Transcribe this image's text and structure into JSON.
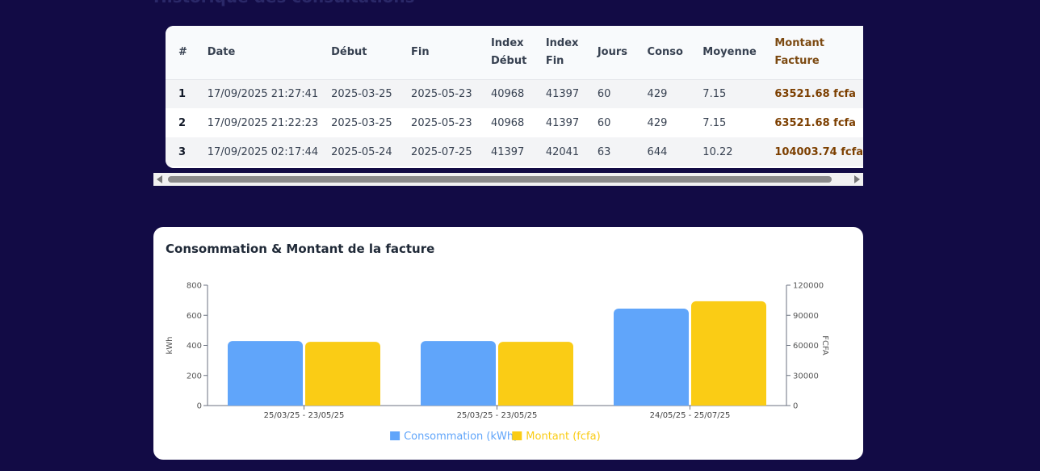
{
  "section_title": "Historique des consultations",
  "table": {
    "headers": {
      "num": "#",
      "date": "Date",
      "debut": "Début",
      "fin": "Fin",
      "index_debut_1": "Index",
      "index_debut_2": "Début",
      "index_fin_1": "Index",
      "index_fin_2": "Fin",
      "jours": "Jours",
      "conso": "Conso",
      "moyenne": "Moyenne",
      "montant_1": "Montant",
      "montant_2": "Facture"
    },
    "rows": [
      {
        "num": "1",
        "date": "17/09/2025 21:27:41",
        "debut": "2025-03-25",
        "fin": "2025-05-23",
        "index_debut": "40968",
        "index_fin": "41397",
        "jours": "60",
        "conso": "429",
        "moyenne": "7.15",
        "montant": "63521.68 fcfa"
      },
      {
        "num": "2",
        "date": "17/09/2025 21:22:23",
        "debut": "2025-03-25",
        "fin": "2025-05-23",
        "index_debut": "40968",
        "index_fin": "41397",
        "jours": "60",
        "conso": "429",
        "moyenne": "7.15",
        "montant": "63521.68 fcfa"
      },
      {
        "num": "3",
        "date": "17/09/2025 02:17:44",
        "debut": "2025-05-24",
        "fin": "2025-07-25",
        "index_debut": "41397",
        "index_fin": "42041",
        "jours": "63",
        "conso": "644",
        "moyenne": "10.22",
        "montant": "104003.74 fcfa"
      }
    ]
  },
  "chart_title": "Consommation & Montant de la facture",
  "chart_data": {
    "type": "bar",
    "title": "Consommation & Montant de la facture",
    "categories": [
      "25/03/25 - 23/05/25",
      "25/03/25 - 23/05/25",
      "24/05/25 - 25/07/25"
    ],
    "series": [
      {
        "name": "Consommation (kWh)",
        "values": [
          429,
          429,
          644
        ],
        "axis": "left",
        "color": "#60a5fa"
      },
      {
        "name": "Montant (fcfa)",
        "values": [
          63521.68,
          63521.68,
          104003.74
        ],
        "axis": "right",
        "color": "#facc15"
      }
    ],
    "ylabel": "kWh",
    "y2label": "FCFA",
    "ylim": [
      0,
      800
    ],
    "y2lim": [
      0,
      120000
    ],
    "yticks": [
      "0",
      "200",
      "400",
      "600",
      "800"
    ],
    "y2ticks": [
      "0",
      "30000",
      "60000",
      "90000",
      "120000"
    ],
    "grid": false,
    "legend": "bottom"
  }
}
